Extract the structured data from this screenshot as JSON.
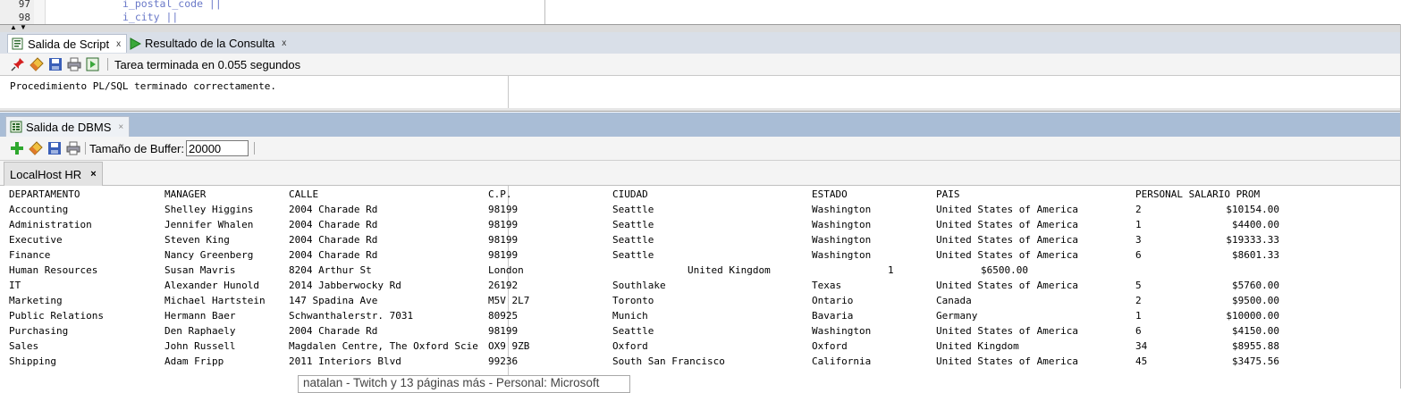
{
  "editor": {
    "lines": [
      {
        "num": "97",
        "code": "i_postal_code ||"
      },
      {
        "num": "98",
        "code": "i_city ||"
      }
    ]
  },
  "script_tabs": [
    {
      "label": "Salida de Script",
      "close": "x",
      "icon": "script-output-icon"
    },
    {
      "label": "Resultado de la Consulta",
      "close": "x",
      "icon": "run-triangle-icon"
    }
  ],
  "script_toolbar": {
    "icons": [
      "pin-icon",
      "eraser-icon",
      "save-icon",
      "print-icon",
      "open-script-icon"
    ],
    "status": "Tarea terminada en 0.055 segundos"
  },
  "script_output": {
    "text": "Procedimiento PL/SQL terminado correctamente."
  },
  "dbms": {
    "tab_label": "Salida de DBMS",
    "tab_close": "×",
    "toolbar_icons": [
      "add-icon",
      "eraser-icon",
      "save-icon",
      "print-icon"
    ],
    "buffer_label": "Tamaño de Buffer:",
    "buffer_value": "20000",
    "connection_tab": "LocalHost HR",
    "connection_close": "×"
  },
  "output": {
    "header": [
      "DEPARTAMENTO",
      "MANAGER",
      "CALLE",
      "C.P.",
      "CIUDAD",
      "ESTADO",
      "PAIS",
      "PERSONAL SALARIO PROM"
    ],
    "rows": [
      [
        "Accounting",
        "Shelley Higgins",
        "2004 Charade Rd",
        "98199",
        "Seattle",
        "Washington",
        "United States of America",
        "2",
        "$10154.00"
      ],
      [
        "Administration",
        "Jennifer Whalen",
        "2004 Charade Rd",
        "98199",
        "Seattle",
        "Washington",
        "United States of America",
        "1",
        "$4400.00"
      ],
      [
        "Executive",
        "Steven King",
        "2004 Charade Rd",
        "98199",
        "Seattle",
        "Washington",
        "United States of America",
        "3",
        "$19333.33"
      ],
      [
        "Finance",
        "Nancy Greenberg",
        "2004 Charade Rd",
        "98199",
        "Seattle",
        "Washington",
        "United States of America",
        "6",
        "$8601.33"
      ],
      [
        "Human Resources",
        "Susan Mavris",
        "8204 Arthur St",
        "London",
        "United Kingdom",
        "1",
        "$6500.00"
      ],
      [
        "IT",
        "Alexander Hunold",
        "2014 Jabberwocky Rd",
        "26192",
        "Southlake",
        "Texas",
        "United States of America",
        "5",
        "$5760.00"
      ],
      [
        "Marketing",
        "Michael Hartstein",
        "147 Spadina Ave",
        "M5V 2L7",
        "Toronto",
        "Ontario",
        "Canada",
        "2",
        "$9500.00"
      ],
      [
        "Public Relations",
        "Hermann Baer",
        "Schwanthalerstr. 7031",
        "80925",
        "Munich",
        "Bavaria",
        "Germany",
        "1",
        "$10000.00"
      ],
      [
        "Purchasing",
        "Den Raphaely",
        "2004 Charade Rd",
        "98199",
        "Seattle",
        "Washington",
        "United States of America",
        "6",
        "$4150.00"
      ],
      [
        "Sales",
        "John Russell",
        "Magdalen Centre, The Oxford Scie",
        "OX9 9ZB",
        "Oxford",
        "Oxford",
        "United Kingdom",
        "34",
        "$8955.88"
      ],
      [
        "Shipping",
        "Adam Fripp",
        "2011 Interiors Blvd",
        "99236",
        "South San Francisco",
        "California",
        "United States of America",
        "45",
        "$3475.56"
      ]
    ]
  },
  "tooltip": "natalan - Twitch y 13 páginas más - Personal: Microsoft"
}
